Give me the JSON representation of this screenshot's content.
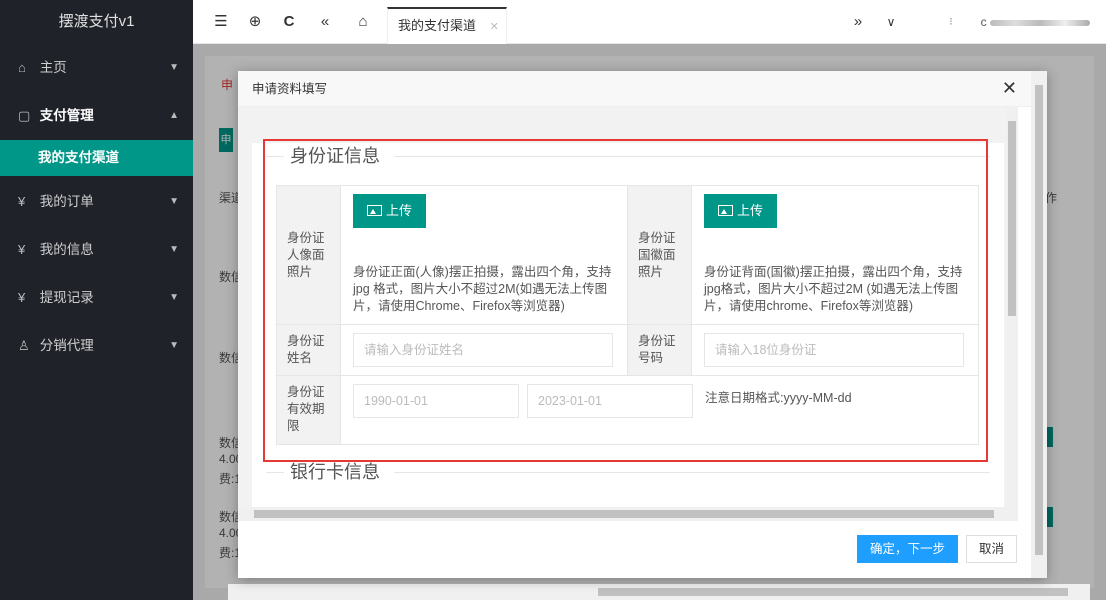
{
  "app": {
    "title": "摆渡支付v1"
  },
  "sidebar": {
    "items": [
      {
        "label": "主页",
        "icon": "home-icon"
      },
      {
        "label": "支付管理",
        "icon": "payment-icon",
        "sub": [
          {
            "label": "我的支付渠道"
          }
        ]
      },
      {
        "label": "我的订单",
        "icon": "yen-icon"
      },
      {
        "label": "我的信息",
        "icon": "yen-icon"
      },
      {
        "label": "提现记录",
        "icon": "yen-icon"
      },
      {
        "label": "分销代理",
        "icon": "user-icon"
      }
    ]
  },
  "topbar": {
    "tab_label": "我的支付渠道"
  },
  "background": {
    "left_labels": [
      "申",
      "申",
      "渠道",
      "数信",
      "数信",
      "数信",
      "4.00",
      "费:1",
      "数信",
      "4.00",
      "费:1"
    ],
    "right_label": "作"
  },
  "modal": {
    "title": "申请资料填写",
    "section1": "身份证信息",
    "section2": "银行卡信息",
    "upload_label": "上传",
    "id_front_label": "身份证人像面照片",
    "id_front_hint": "身份证正面(人像)摆正拍摄，露出四个角，支持jpg 格式，图片大小不超过2M(如遇无法上传图片，请使用Chrome、Firefox等浏览器)",
    "id_back_label": "身份证国徽面照片",
    "id_back_hint": "身份证背面(国徽)摆正拍摄，露出四个角，支持jpg格式，图片大小不超过2M (如遇无法上传图片，请使用chrome、Firefox等浏览器)",
    "name_label": "身份证姓名",
    "name_placeholder": "请输入身份证姓名",
    "number_label": "身份证号码",
    "number_placeholder": "请输入18位身份证",
    "validity_label": "身份证有效期限",
    "start_placeholder": "1990-01-01",
    "end_placeholder": "2023-01-01",
    "date_note": "注意日期格式:yyyy-MM-dd",
    "confirm_label": "确定，下一步",
    "cancel_label": "取消"
  }
}
